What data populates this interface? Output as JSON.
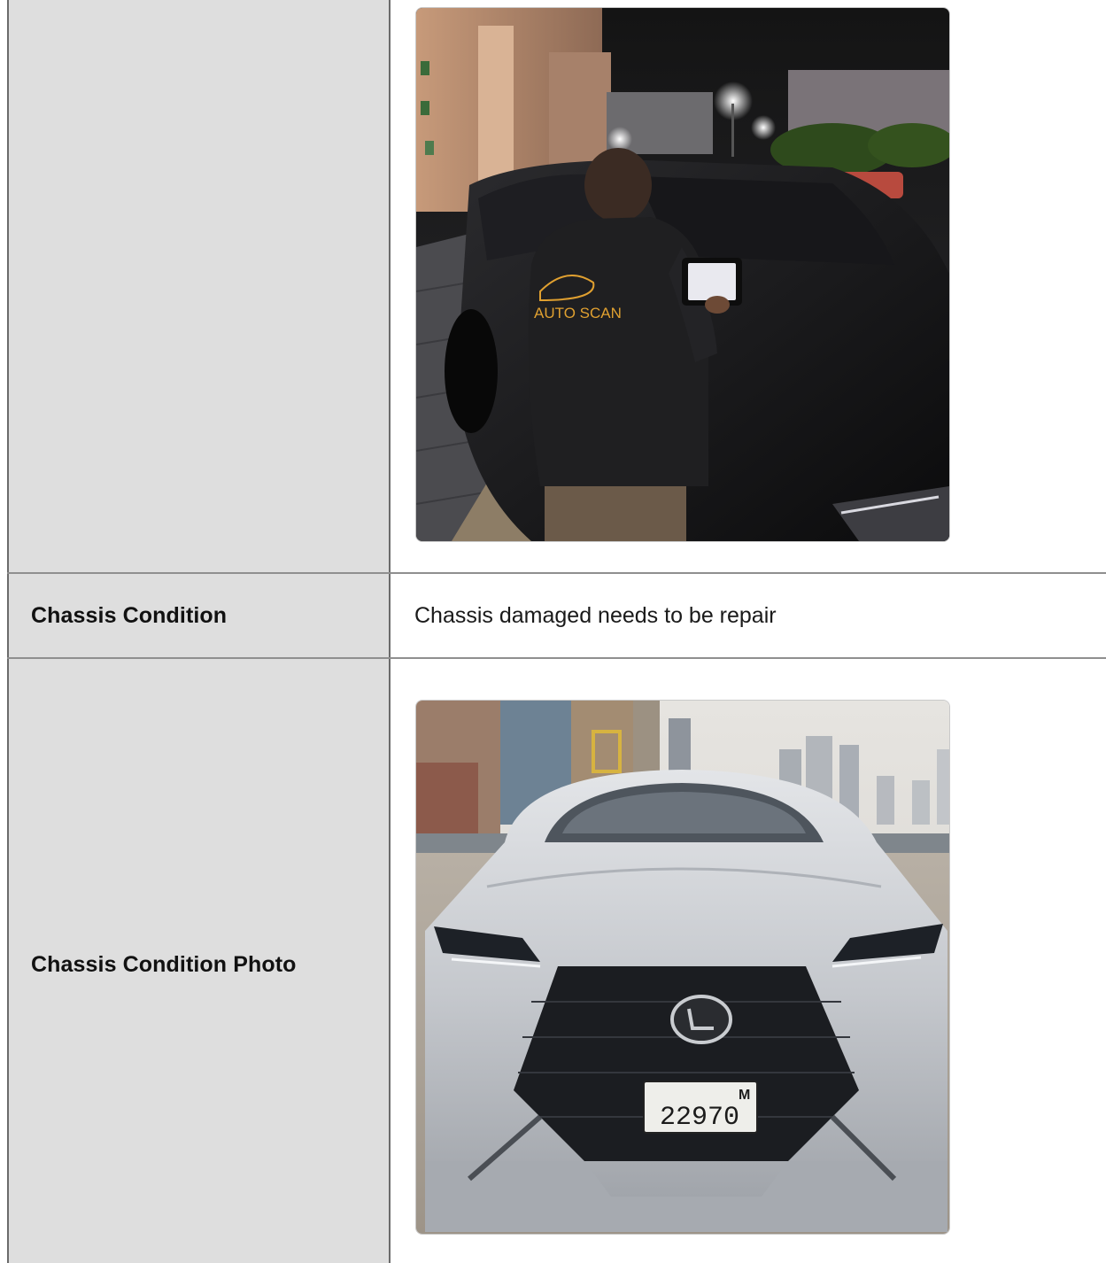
{
  "rows": [
    {
      "label": "",
      "photo": {
        "name": "inspector-night-photo",
        "shirt_text": "AUTO SCAN"
      }
    },
    {
      "label": "Chassis Condition",
      "value": "Chassis damaged needs to be repair"
    },
    {
      "label": "Chassis Condition Photo",
      "photo": {
        "name": "lexus-front-photo",
        "plate_number": "22970",
        "plate_letter": "M"
      }
    }
  ]
}
